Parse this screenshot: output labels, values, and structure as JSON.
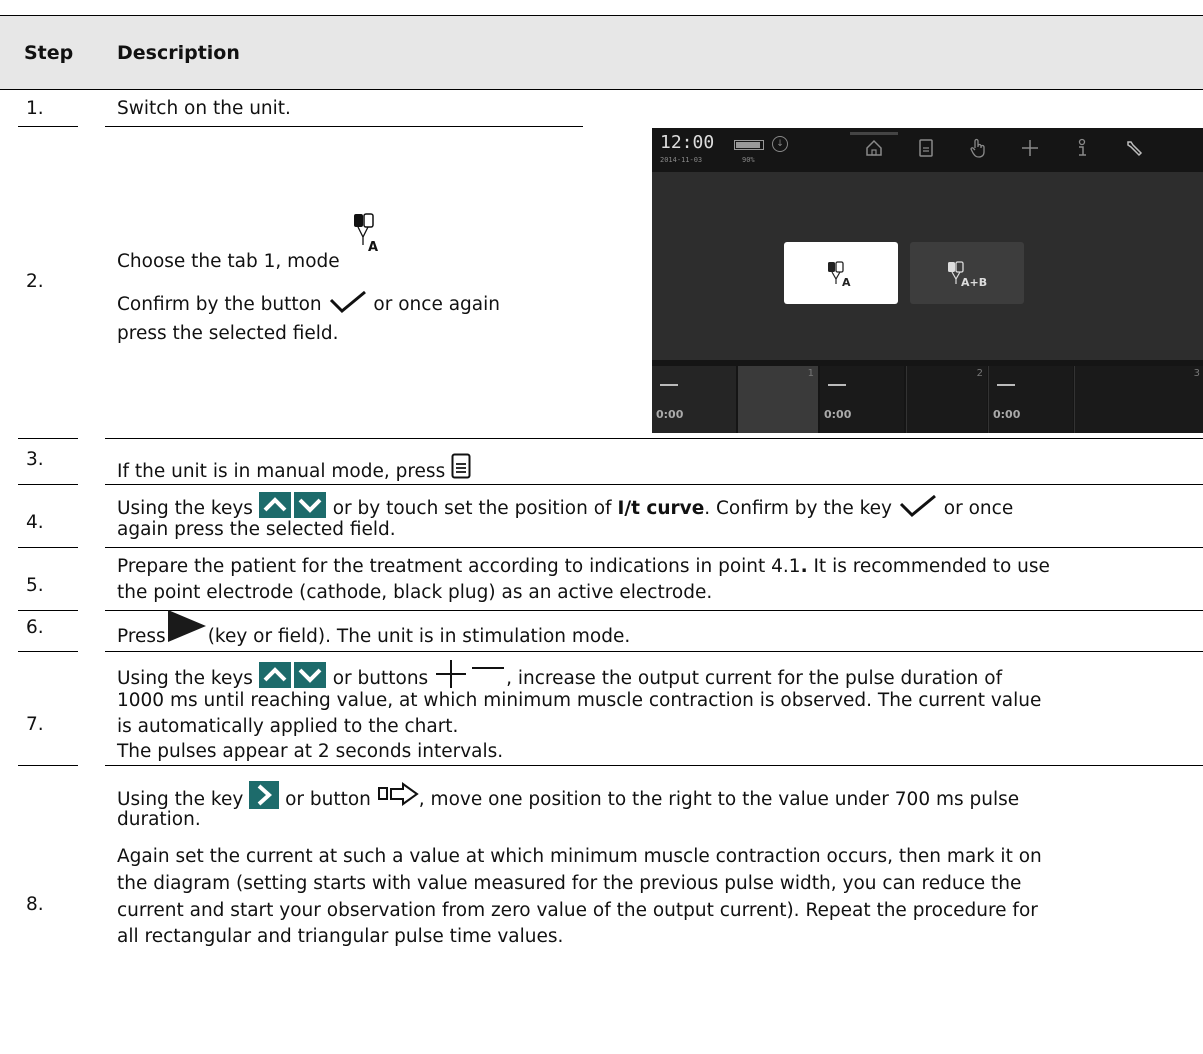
{
  "table": {
    "header": {
      "step": "Step",
      "description": "Description"
    },
    "rows": [
      {
        "step": "1.",
        "lines": [
          "Switch on the unit."
        ]
      },
      {
        "step": "2.",
        "line1": "Choose the tab 1, mode",
        "line2a": "Confirm by the button",
        "line2b": "or once again",
        "line3": "press the selected field."
      },
      {
        "step": "3.",
        "line1": "If the unit is in manual mode, press"
      },
      {
        "step": "4.",
        "l1a": "Using the keys",
        "l1b": "or by touch set the position of",
        "l1bold": "I/t curve",
        "l1c": ". Confirm by the key",
        "l1d": "or once",
        "l2": "again press the selected field."
      },
      {
        "step": "5.",
        "l1a": "Prepare the patient for the treatment according to indications in point 4.1",
        "l1bold": ".",
        "l1c": " It is recommended to use",
        "l2": "the point electrode (cathode, black plug) as an active electrode."
      },
      {
        "step": "6.",
        "l1a": "Press",
        "l1b": "(key or field). The unit is in stimulation mode."
      },
      {
        "step": "7.",
        "l1a": "Using the keys",
        "l1b": "or buttons",
        "l1c": ", increase the output current for the pulse duration of",
        "l2": "1000 ms until reaching value, at which minimum muscle contraction is observed. The current value",
        "l3": "is automatically applied to the chart.",
        "l4": "The pulses appear at 2 seconds intervals."
      },
      {
        "step": "8.",
        "l1a": "Using the key",
        "l1b": "or button",
        "l1c": ", move one position to the right to the value under 700 ms pulse",
        "l2": "duration.",
        "l3": "Again set the current at such a value at which minimum muscle contraction occurs, then mark it on",
        "l4": "the diagram (setting starts with value measured for the previous pulse width, you can reduce the",
        "l5": "current and start your observation from zero value of the output current). Repeat the procedure for",
        "l6": "all rectangular and triangular pulse time values."
      }
    ]
  },
  "screen": {
    "time": "12:00",
    "date": "2014-11-03",
    "battery": "90%",
    "nav_icons": [
      "home-icon",
      "document-icon",
      "hand-icon",
      "plus-icon",
      "info-icon",
      "wrench-icon"
    ],
    "mode_a_sub": "A",
    "mode_ab_sub": "A+B",
    "channels": [
      {
        "num": "1",
        "time": "0:00"
      },
      {
        "num": "2",
        "time": "0:00"
      },
      {
        "num": "3",
        "time": "0:00"
      }
    ]
  },
  "icons": {
    "mode_sub": "A"
  },
  "colors": {
    "header_bg": "#e7e7e7",
    "screen_bg": "#151515",
    "panel_bg": "#2d2d2d"
  }
}
